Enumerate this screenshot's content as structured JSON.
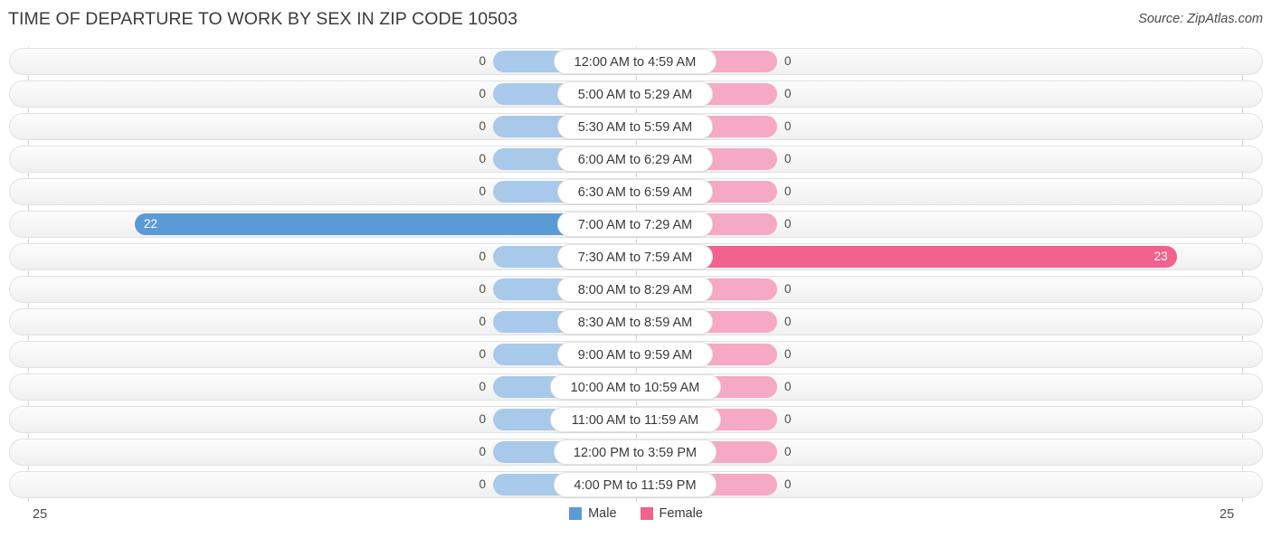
{
  "header": {
    "title": "TIME OF DEPARTURE TO WORK BY SEX IN ZIP CODE 10503",
    "source": "Source: ZipAtlas.com"
  },
  "axis": {
    "left_tick": "25",
    "right_tick": "25"
  },
  "legend": {
    "items": [
      {
        "label": "Male",
        "color": "#5b9bd5"
      },
      {
        "label": "Female",
        "color": "#f2628f"
      }
    ]
  },
  "colors": {
    "male_light": "#a9c9ea",
    "male_strong": "#5b9bd5",
    "female_light": "#f5a9c5",
    "female_strong": "#f2628f",
    "track": "#f6f6f6",
    "gridline": "#d9d9d9"
  },
  "chart_data": {
    "type": "bar",
    "title": "TIME OF DEPARTURE TO WORK BY SEX IN ZIP CODE 10503",
    "subtitle": "Source: ZipAtlas.com",
    "orientation": "horizontal-diverging",
    "xlabel": "",
    "ylabel": "",
    "xlim": [
      25,
      25
    ],
    "grid": true,
    "legend_position": "bottom-center",
    "categories": [
      "12:00 AM to 4:59 AM",
      "5:00 AM to 5:29 AM",
      "5:30 AM to 5:59 AM",
      "6:00 AM to 6:29 AM",
      "6:30 AM to 6:59 AM",
      "7:00 AM to 7:29 AM",
      "7:30 AM to 7:59 AM",
      "8:00 AM to 8:29 AM",
      "8:30 AM to 8:59 AM",
      "9:00 AM to 9:59 AM",
      "10:00 AM to 10:59 AM",
      "11:00 AM to 11:59 AM",
      "12:00 PM to 3:59 PM",
      "4:00 PM to 11:59 PM"
    ],
    "series": [
      {
        "name": "Male",
        "values": [
          0,
          0,
          0,
          0,
          0,
          22,
          0,
          0,
          0,
          0,
          0,
          0,
          0,
          0
        ],
        "labels": [
          "0",
          "0",
          "0",
          "0",
          "0",
          "22",
          "0",
          "0",
          "0",
          "0",
          "0",
          "0",
          "0",
          "0"
        ]
      },
      {
        "name": "Female",
        "values": [
          0,
          0,
          0,
          0,
          0,
          0,
          23,
          0,
          0,
          0,
          0,
          0,
          0,
          0
        ],
        "labels": [
          "0",
          "0",
          "0",
          "0",
          "0",
          "0",
          "23",
          "0",
          "0",
          "0",
          "0",
          "0",
          "0",
          "0"
        ]
      }
    ]
  }
}
